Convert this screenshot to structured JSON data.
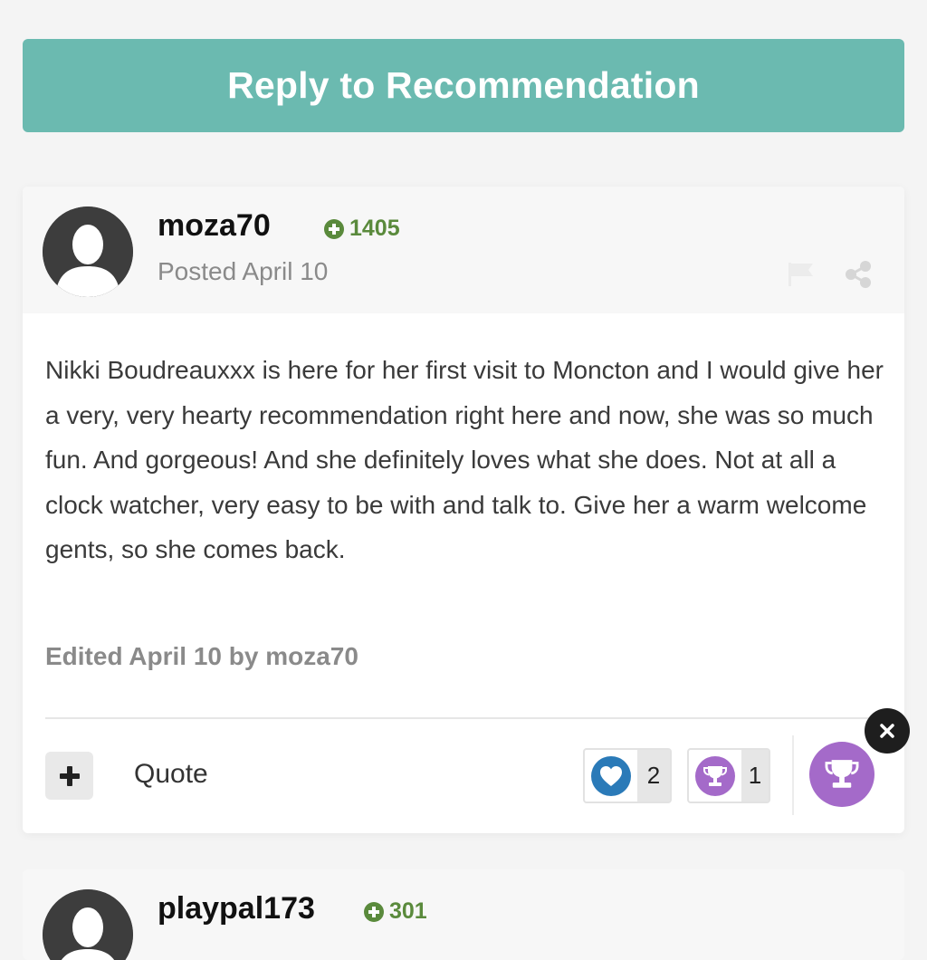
{
  "reply_button": {
    "label": "Reply to Recommendation"
  },
  "posts": [
    {
      "username": "moza70",
      "reputation": "1405",
      "posted": "Posted April 10",
      "body": "Nikki Boudreauxxx is here for her first visit to Moncton and I would give her a very, very hearty recommendation right here and now, she was so much fun. And gorgeous! And she definitely loves what she does. Not at all a clock watcher, very easy to be with and talk to. Give her a warm welcome gents, so she comes back.",
      "edited": "Edited April 10 by moza70",
      "actions": {
        "quote_label": "Quote"
      },
      "reactions": [
        {
          "icon": "heart-icon",
          "count": "2",
          "color": "#2a7ab8"
        },
        {
          "icon": "trophy-icon",
          "count": "1",
          "color": "#a46ac9"
        }
      ],
      "react_icon": "trophy-icon"
    },
    {
      "username": "playpal173",
      "reputation": "301"
    }
  ],
  "colors": {
    "accent": "#6bbab0",
    "reputation": "#5a8a3c",
    "trophy": "#a46ac9",
    "heart": "#2a7ab8"
  }
}
